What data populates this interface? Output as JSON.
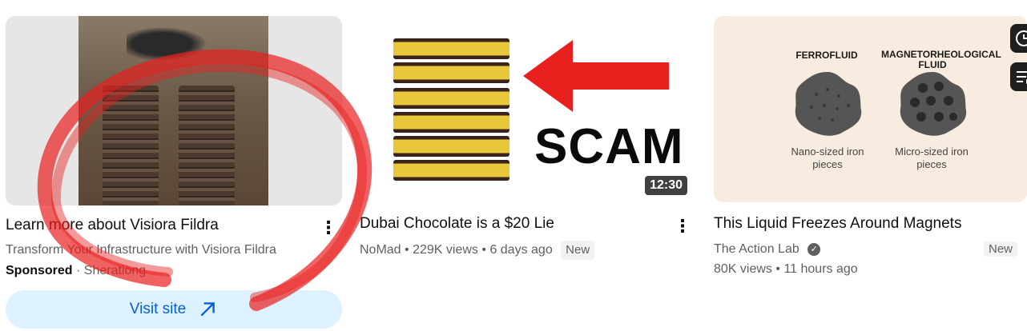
{
  "ad": {
    "title": "Learn more about Visiora Fildra",
    "description": "Transform Your Infrastructure with Visiora Fildra",
    "sponsored_label": "Sponsored",
    "separator": "·",
    "advertiser": "Sherationg",
    "visit_label": "Visit site"
  },
  "videos": [
    {
      "title": "Dubai Chocolate is a $20 Lie",
      "channel": "NoMad",
      "views": "229K views",
      "age": "6 days ago",
      "badge": "New",
      "duration": "12:30",
      "thumb_text": "SCAM"
    },
    {
      "title": "This Liquid Freezes Around Magnets",
      "channel": "The Action Lab",
      "views": "80K views",
      "age": "11 hours ago",
      "badge": "New",
      "thumb_labels": {
        "left_heading": "FERROFLUID",
        "right_heading": "MAGNETORHEOLOGICAL FLUID",
        "left_caption": "Nano-sized iron pieces",
        "right_caption": "Micro-sized iron pieces"
      }
    }
  ],
  "bullet": "•",
  "more_icon": "⋮",
  "colors": {
    "link_blue": "#065fd4",
    "visit_bg": "#def1ff",
    "annotation_red": "#e8201e"
  }
}
